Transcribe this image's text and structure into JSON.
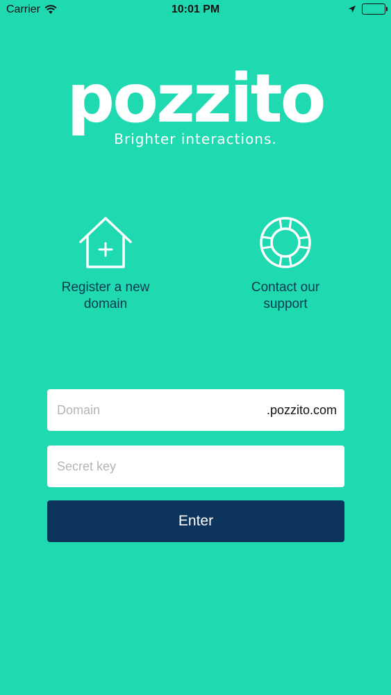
{
  "status_bar": {
    "carrier": "Carrier",
    "time": "10:01 PM"
  },
  "brand": {
    "logo": "pozzito",
    "tagline": "Brighter interactions."
  },
  "actions": {
    "register": {
      "line1": "Register a new",
      "line2": "domain",
      "icon": "house-plus-icon"
    },
    "support": {
      "line1": "Contact our",
      "line2": "support",
      "icon": "lifebuoy-icon"
    }
  },
  "form": {
    "domain_placeholder": "Domain",
    "domain_suffix": ".pozzito.com",
    "secret_placeholder": "Secret key",
    "enter_label": "Enter"
  },
  "colors": {
    "background": "#1fd9b1",
    "button": "#0c345c",
    "label_text": "#0b3a4f"
  }
}
